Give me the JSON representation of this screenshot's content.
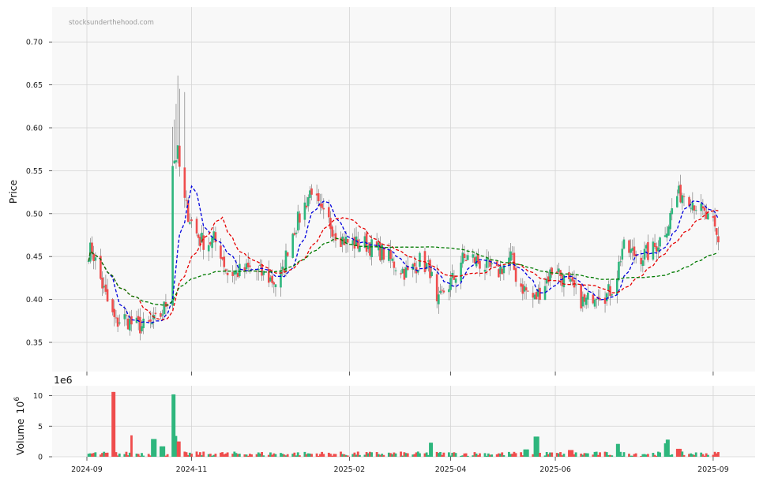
{
  "chart_data": [
    {
      "type": "candlestick",
      "watermark": "stocksunderthehood.com",
      "ylabel": "Price",
      "ylim": [
        0.315,
        0.745
      ],
      "y_ticks": [
        "0.35",
        "0.40",
        "0.45",
        "0.50",
        "0.55",
        "0.60",
        "0.65",
        "0.70"
      ],
      "x_ticks": [
        {
          "date": "2024-09-01",
          "label": "2024-09"
        },
        {
          "date": "2024-11-01",
          "label": "2024-11"
        },
        {
          "date": "2025-02-01",
          "label": "2025-02"
        },
        {
          "date": "2025-04-01",
          "label": "2025-04"
        },
        {
          "date": "2025-06-01",
          "label": "2025-06"
        },
        {
          "date": "2025-09-01",
          "label": "2025-09"
        }
      ],
      "grid": true,
      "colors": {
        "up": "#2eb67d",
        "down": "#ef4d4d",
        "wick": "#6b6b6b",
        "ma_short": "#0000dd",
        "ma_mid": "#e60000",
        "ma_long": "#007a00",
        "background": "#f8f8f8",
        "grid": "#d4d4d4"
      },
      "close_anchors": [
        [
          "2024-09-01",
          0.455
        ],
        [
          "2024-09-04",
          0.458
        ],
        [
          "2024-09-08",
          0.43
        ],
        [
          "2024-09-11",
          0.41
        ],
        [
          "2024-09-14",
          0.39
        ],
        [
          "2024-09-18",
          0.372
        ],
        [
          "2024-09-22",
          0.38
        ],
        [
          "2024-09-28",
          0.37
        ],
        [
          "2024-10-05",
          0.368
        ],
        [
          "2024-10-12",
          0.375
        ],
        [
          "2024-10-16",
          0.39
        ],
        [
          "2024-10-19",
          0.405
        ],
        [
          "2024-10-21",
          0.56
        ],
        [
          "2024-10-24",
          0.57
        ],
        [
          "2024-10-27",
          0.52
        ],
        [
          "2024-10-30",
          0.5
        ],
        [
          "2024-11-03",
          0.48
        ],
        [
          "2024-11-06",
          0.47
        ],
        [
          "2024-11-10",
          0.465
        ],
        [
          "2024-11-14",
          0.47
        ],
        [
          "2024-11-18",
          0.455
        ],
        [
          "2024-11-22",
          0.43
        ],
        [
          "2024-11-28",
          0.432
        ],
        [
          "2024-12-05",
          0.435
        ],
        [
          "2024-12-12",
          0.43
        ],
        [
          "2024-12-20",
          0.42
        ],
        [
          "2024-12-24",
          0.43
        ],
        [
          "2024-12-28",
          0.47
        ],
        [
          "2025-01-04",
          0.5
        ],
        [
          "2025-01-10",
          0.53
        ],
        [
          "2025-01-15",
          0.5
        ],
        [
          "2025-01-20",
          0.49
        ],
        [
          "2025-01-25",
          0.475
        ],
        [
          "2025-02-01",
          0.465
        ],
        [
          "2025-02-10",
          0.465
        ],
        [
          "2025-02-20",
          0.455
        ],
        [
          "2025-02-28",
          0.44
        ],
        [
          "2025-03-07",
          0.43
        ],
        [
          "2025-03-14",
          0.445
        ],
        [
          "2025-03-20",
          0.435
        ],
        [
          "2025-03-24",
          0.39
        ],
        [
          "2025-03-28",
          0.41
        ],
        [
          "2025-04-03",
          0.425
        ],
        [
          "2025-04-07",
          0.445
        ],
        [
          "2025-04-12",
          0.45
        ],
        [
          "2025-04-20",
          0.44
        ],
        [
          "2025-04-28",
          0.43
        ],
        [
          "2025-05-02",
          0.44
        ],
        [
          "2025-05-06",
          0.45
        ],
        [
          "2025-05-10",
          0.42
        ],
        [
          "2025-05-15",
          0.41
        ],
        [
          "2025-05-20",
          0.4
        ],
        [
          "2025-05-26",
          0.42
        ],
        [
          "2025-06-01",
          0.44
        ],
        [
          "2025-06-05",
          0.425
        ],
        [
          "2025-06-12",
          0.41
        ],
        [
          "2025-06-18",
          0.395
        ],
        [
          "2025-06-25",
          0.41
        ],
        [
          "2025-07-01",
          0.405
        ],
        [
          "2025-07-06",
          0.42
        ],
        [
          "2025-07-10",
          0.46
        ],
        [
          "2025-07-15",
          0.455
        ],
        [
          "2025-07-20",
          0.45
        ],
        [
          "2025-07-27",
          0.455
        ],
        [
          "2025-08-01",
          0.47
        ],
        [
          "2025-08-06",
          0.49
        ],
        [
          "2025-08-10",
          0.52
        ],
        [
          "2025-08-16",
          0.525
        ],
        [
          "2025-08-22",
          0.51
        ],
        [
          "2025-08-26",
          0.5
        ],
        [
          "2025-09-01",
          0.485
        ],
        [
          "2025-09-04",
          0.465
        ]
      ],
      "series": [
        {
          "kind": "candles",
          "start": "2024-09-01",
          "end": "2025-09-04"
        },
        {
          "kind": "moving-average",
          "style": "dashed",
          "color": "#0000dd",
          "window": 10
        },
        {
          "kind": "moving-average",
          "style": "dashed",
          "color": "#e60000",
          "window": 22
        },
        {
          "kind": "moving-average",
          "style": "dashed",
          "color": "#007a00",
          "window": 70
        }
      ]
    },
    {
      "type": "bar",
      "ylabel": "Volume",
      "ylabel_exponent": "10",
      "ylabel_superscript": "6",
      "offset_label": "1e6",
      "ylim": [
        0,
        11.5
      ],
      "y_ticks": [
        "0",
        "5",
        "10"
      ],
      "baseline_million": 0.45,
      "spikes_million": [
        [
          "2024-09-16",
          10.6,
          "down"
        ],
        [
          "2024-10-21",
          10.2,
          "up"
        ],
        [
          "2024-09-28",
          3.5,
          "down"
        ],
        [
          "2024-10-10",
          2.9,
          "up"
        ],
        [
          "2024-10-22",
          3.4,
          "up"
        ],
        [
          "2024-10-15",
          1.7,
          "up"
        ],
        [
          "2024-10-24",
          2.5,
          "down"
        ],
        [
          "2025-03-21",
          2.3,
          "up"
        ],
        [
          "2025-05-21",
          3.3,
          "up"
        ],
        [
          "2025-07-07",
          2.1,
          "up"
        ],
        [
          "2025-08-05",
          2.8,
          "up"
        ],
        [
          "2025-08-03",
          2.2,
          "up"
        ],
        [
          "2025-05-15",
          1.2,
          "up"
        ],
        [
          "2025-08-12",
          1.3,
          "down"
        ],
        [
          "2025-06-10",
          1.1,
          "down"
        ]
      ],
      "x_ticks": [
        "2024-09",
        "2024-11",
        "2025-02",
        "2025-04",
        "2025-06",
        "2025-09"
      ]
    }
  ]
}
